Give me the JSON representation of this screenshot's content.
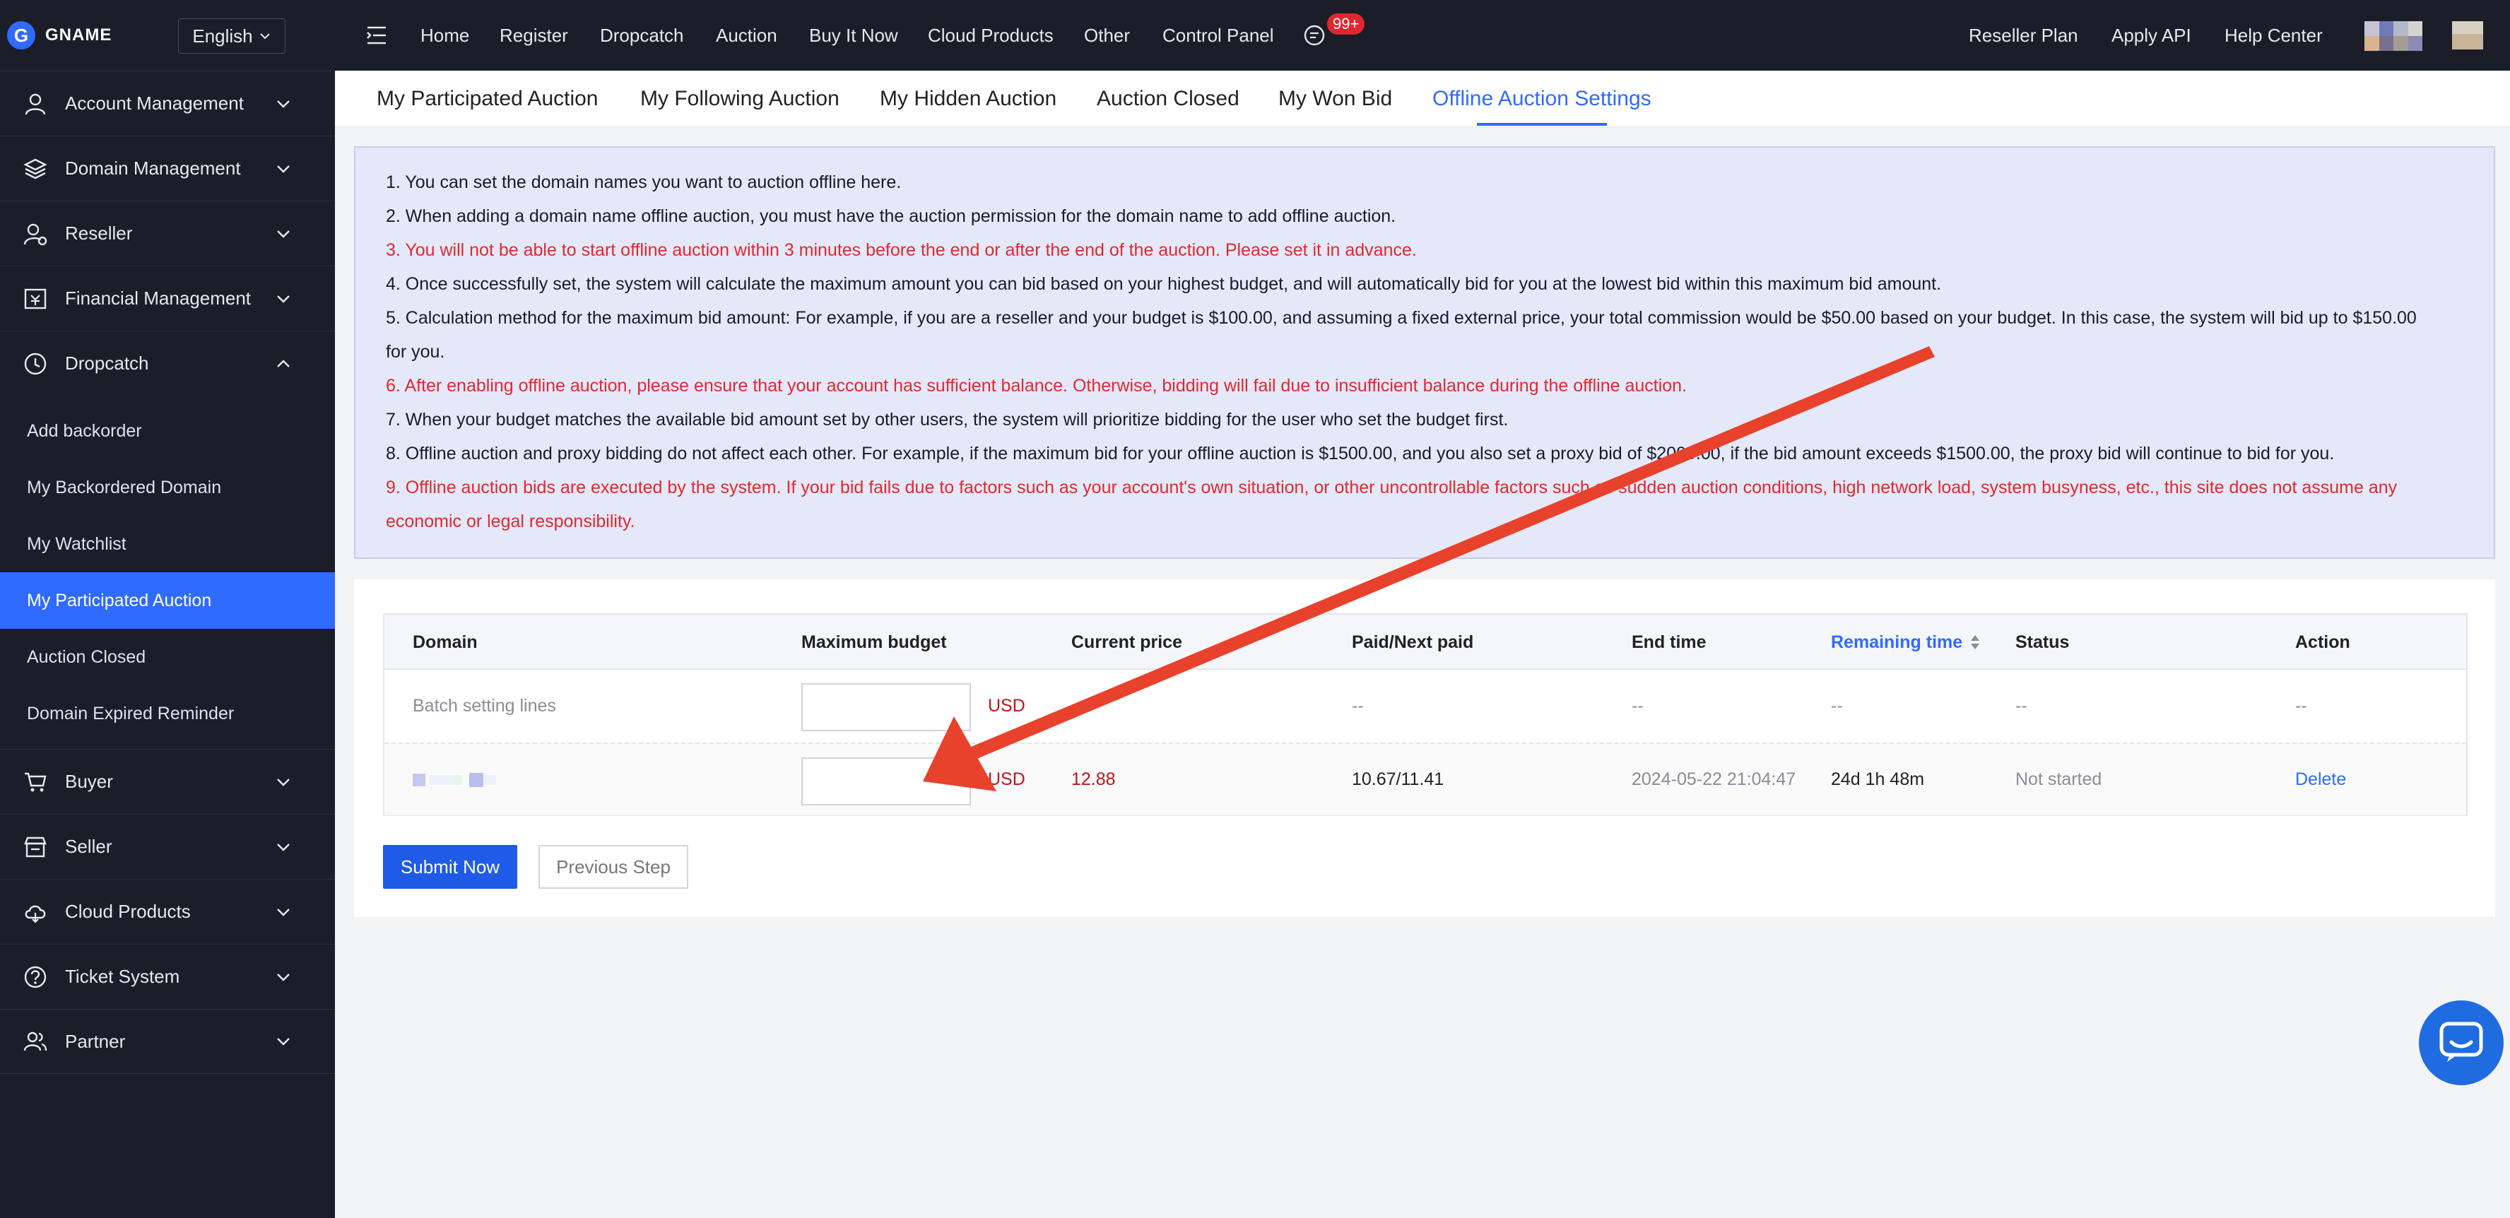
{
  "brand": {
    "logo_letter": "G",
    "name": "GNAME"
  },
  "language": {
    "label": "English"
  },
  "sidebar": {
    "menus": [
      {
        "label": "Account Management",
        "icon": "user-icon"
      },
      {
        "label": "Domain Management",
        "icon": "layers-icon"
      },
      {
        "label": "Reseller",
        "icon": "reseller-icon"
      },
      {
        "label": "Financial Management",
        "icon": "finance-icon"
      },
      {
        "label": "Dropcatch",
        "icon": "clock-icon"
      }
    ],
    "dropcatch_items": [
      "Add backorder",
      "My Backordered Domain",
      "My Watchlist",
      "My Participated Auction",
      "Auction Closed",
      "Domain Expired Reminder"
    ],
    "active_item": "My Participated Auction",
    "menus_bottom": [
      {
        "label": "Buyer",
        "icon": "cart-icon"
      },
      {
        "label": "Seller",
        "icon": "store-icon"
      },
      {
        "label": "Cloud Products",
        "icon": "cloud-icon"
      },
      {
        "label": "Ticket System",
        "icon": "help-circle-icon"
      },
      {
        "label": "Partner",
        "icon": "partner-icon"
      }
    ]
  },
  "topnav": {
    "left": [
      "Home",
      "Register",
      "Dropcatch",
      "Auction",
      "Buy It Now",
      "Cloud Products",
      "Other",
      "Control Panel"
    ],
    "badge": "99+",
    "right": [
      "Reseller Plan",
      "Apply API",
      "Help Center"
    ]
  },
  "tabs": [
    "My Participated Auction",
    "My Following Auction",
    "My Hidden Auction",
    "Auction Closed",
    "My Won Bid",
    "Offline Auction Settings"
  ],
  "active_tab": "Offline Auction Settings",
  "notice": [
    {
      "text": "1. You can set the domain names you want to auction offline here.",
      "red": false
    },
    {
      "text": "2. When adding a domain name offline auction, you must have the auction permission for the domain name to add offline auction.",
      "red": false
    },
    {
      "text": "3. You will not be able to start offline auction within 3 minutes before the end or after the end of the auction. Please set it in advance.",
      "red": true
    },
    {
      "text": "4. Once successfully set, the system will calculate the maximum amount you can bid based on your highest budget, and will automatically bid for you at the lowest bid within this maximum bid amount.",
      "red": false
    },
    {
      "text": "5. Calculation method for the maximum bid amount: For example, if you are a reseller and your budget is $100.00, and assuming a fixed external price, your total commission would be $50.00 based on your budget. In this case, the system will bid up to $150.00",
      "red": false
    },
    {
      "text": "for you.",
      "red": false
    },
    {
      "text": "6. After enabling offline auction, please ensure that your account has sufficient balance. Otherwise, bidding will fail due to insufficient balance during the offline auction.",
      "red": true
    },
    {
      "text": "7. When your budget matches the available bid amount set by other users, the system will prioritize bidding for the user who set the budget first.",
      "red": false
    },
    {
      "text": "8. Offline auction and proxy bidding do not affect each other. For example, if the maximum bid for your offline auction is $1500.00, and you also set a proxy bid of $2000.00, if the bid amount exceeds $1500.00, the proxy bid will continue to bid for you.",
      "red": false
    },
    {
      "text": "9. Offline auction bids are executed by the system. If your bid fails due to factors such as your account's own situation, or other uncontrollable factors such as sudden auction conditions, high network load, system busyness, etc., this site does not assume any",
      "red": true
    },
    {
      "text": "economic or legal responsibility.",
      "red": true
    }
  ],
  "table": {
    "headers": [
      "Domain",
      "Maximum budget",
      "Current price",
      "Paid/Next paid",
      "End time",
      "Remaining time",
      "Status",
      "Action"
    ],
    "sorted_column": "Remaining time",
    "batch_row": {
      "domain": "Batch setting lines",
      "currency": "USD",
      "paid": "--",
      "end": "--",
      "remaining": "--",
      "status": "--",
      "action": "--"
    },
    "rows": [
      {
        "domain": "",
        "currency": "USD",
        "current_price": "12.88",
        "paid": "10.67/11.41",
        "end": "2024-05-22 21:04:47",
        "remaining": "24d 1h 48m",
        "status": "Not started",
        "action": "Delete"
      }
    ]
  },
  "buttons": {
    "submit": "Submit Now",
    "previous": "Previous Step"
  },
  "colors": {
    "accent": "#2f6bff",
    "sidebar_bg": "#1b1e28",
    "notice_bg": "#e4e8f8",
    "warning_red": "#e1292f",
    "arrow_red": "#e8412c"
  }
}
